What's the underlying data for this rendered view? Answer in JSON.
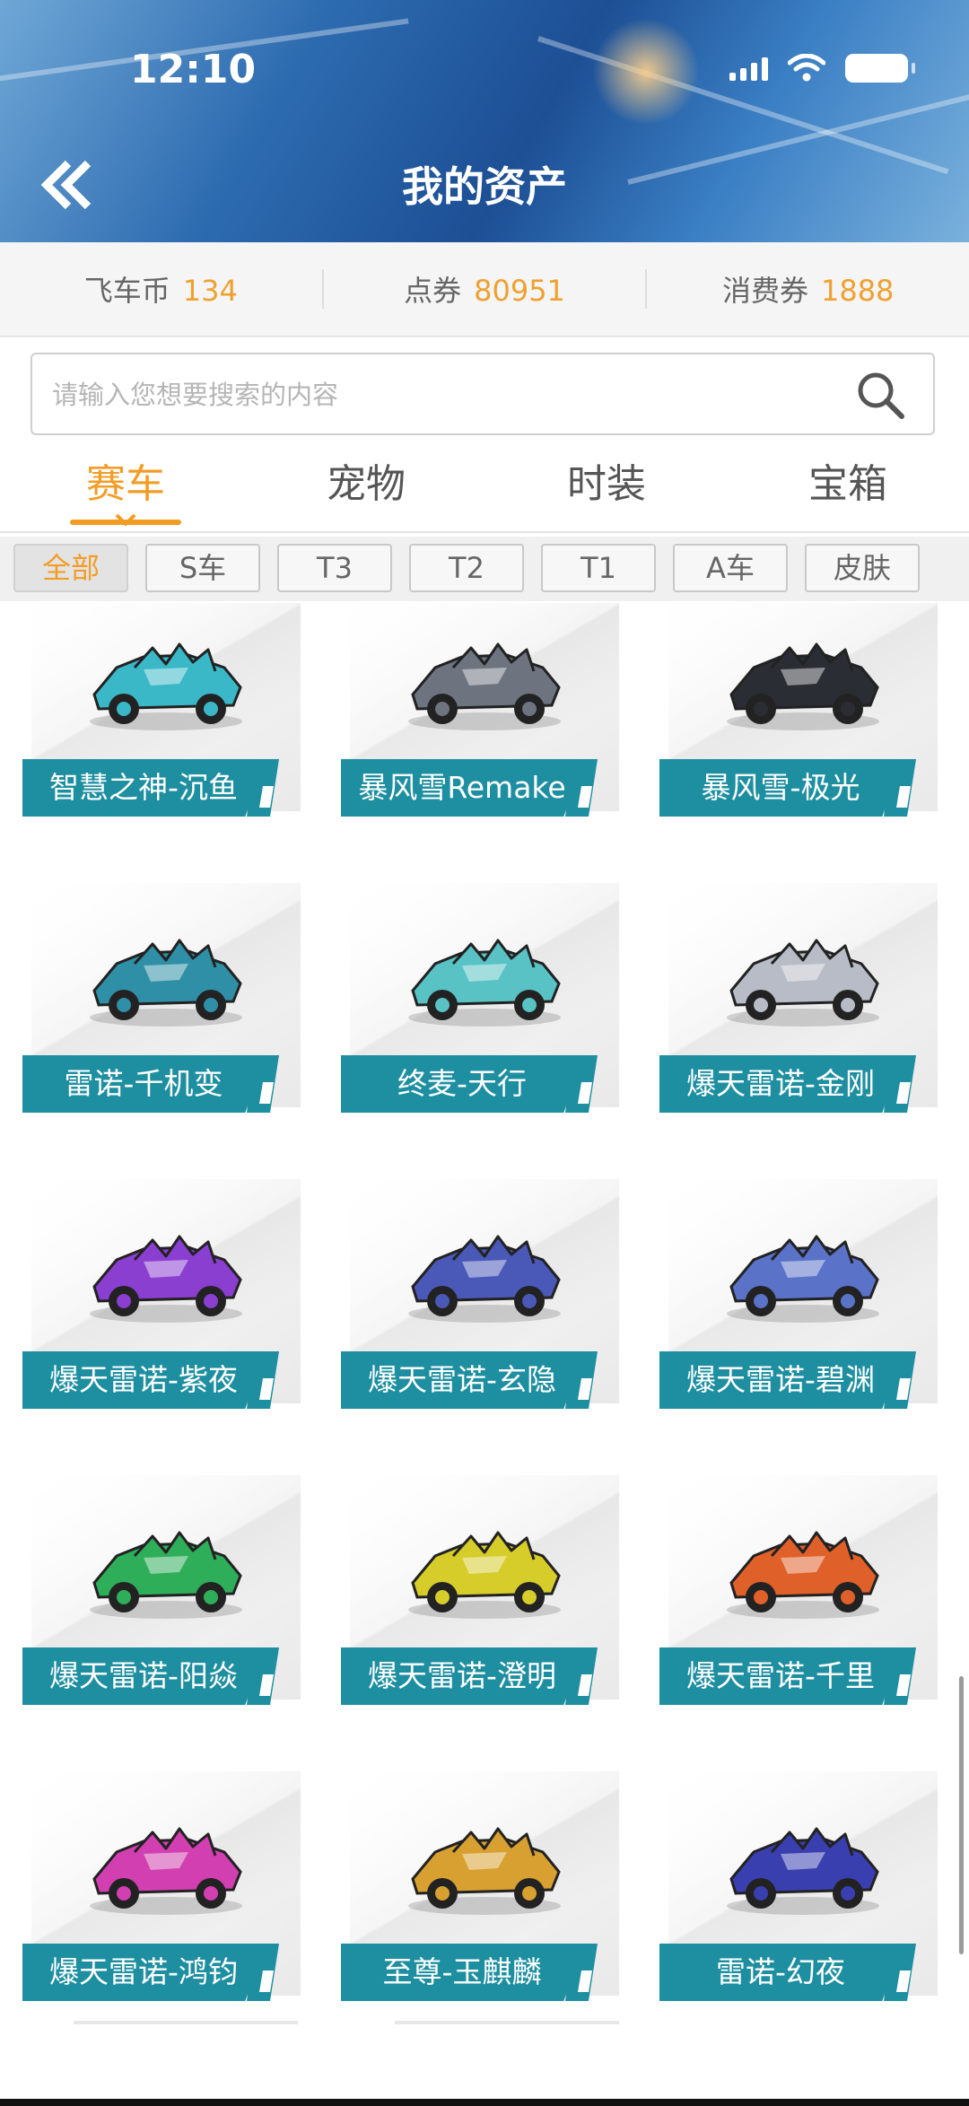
{
  "status_bar": {
    "time": "12:10"
  },
  "header": {
    "title": "我的资产"
  },
  "balances": [
    {
      "label": "飞车币",
      "value": "134"
    },
    {
      "label": "点券",
      "value": "80951"
    },
    {
      "label": "消费券",
      "value": "1888"
    }
  ],
  "search": {
    "placeholder": "请输入您想要搜索的内容"
  },
  "tabs": [
    {
      "label": "赛车",
      "active": true
    },
    {
      "label": "宠物",
      "active": false
    },
    {
      "label": "时装",
      "active": false
    },
    {
      "label": "宝箱",
      "active": false
    }
  ],
  "filters": [
    {
      "label": "全部",
      "active": true
    },
    {
      "label": "S车",
      "active": false
    },
    {
      "label": "T3",
      "active": false
    },
    {
      "label": "T2",
      "active": false
    },
    {
      "label": "T1",
      "active": false
    },
    {
      "label": "A车",
      "active": false
    },
    {
      "label": "皮肤",
      "active": false
    }
  ],
  "colors": {
    "accent": "#f39c25",
    "label_bg": "#1e8fa1",
    "currency": "#f0a030"
  },
  "cars": [
    {
      "name": "智慧之神-沉鱼",
      "color": "#3bb8c8",
      "icon": "race-car-icon"
    },
    {
      "name": "暴风雪Remake",
      "color": "#6d7480",
      "icon": "race-car-icon"
    },
    {
      "name": "暴风雪-极光",
      "color": "#2a2d33",
      "icon": "race-car-icon"
    },
    {
      "name": "雷诺-千机变",
      "color": "#2f8fa6",
      "icon": "race-car-icon"
    },
    {
      "name": "终麦-天行",
      "color": "#58c2c4",
      "icon": "race-car-icon"
    },
    {
      "name": "爆天雷诺-金刚",
      "color": "#b8bcc6",
      "icon": "race-car-icon"
    },
    {
      "name": "爆天雷诺-紫夜",
      "color": "#8a3fd0",
      "icon": "race-car-icon"
    },
    {
      "name": "爆天雷诺-玄隐",
      "color": "#4a58b8",
      "icon": "race-car-icon"
    },
    {
      "name": "爆天雷诺-碧渊",
      "color": "#5a72c8",
      "icon": "race-car-icon"
    },
    {
      "name": "爆天雷诺-阳焱",
      "color": "#2fae5a",
      "icon": "race-car-icon"
    },
    {
      "name": "爆天雷诺-澄明",
      "color": "#d6cc2a",
      "icon": "race-car-icon"
    },
    {
      "name": "爆天雷诺-千里",
      "color": "#e0602a",
      "icon": "race-car-icon"
    },
    {
      "name": "爆天雷诺-鸿钧",
      "color": "#d23fb0",
      "icon": "race-car-icon"
    },
    {
      "name": "至尊-玉麒麟",
      "color": "#d8a030",
      "icon": "race-car-icon"
    },
    {
      "name": "雷诺-幻夜",
      "color": "#3a3fb0",
      "icon": "race-car-icon"
    }
  ]
}
